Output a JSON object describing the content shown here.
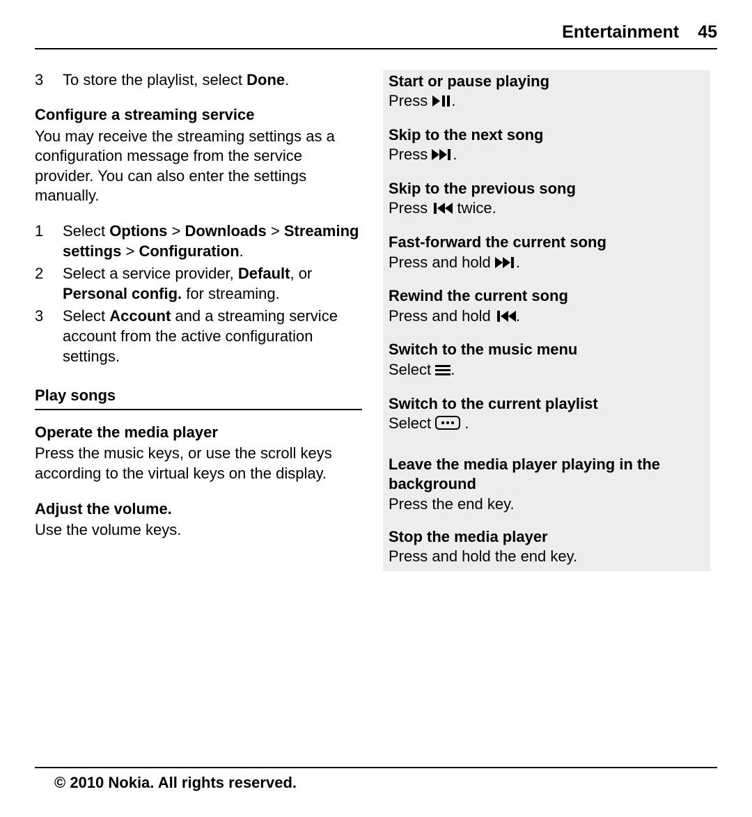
{
  "header": {
    "title": "Entertainment",
    "page_number": "45"
  },
  "left": {
    "intro_step": {
      "num": "3",
      "text_before": "To store the playlist, select ",
      "bold": "Done",
      "text_after": "."
    },
    "configure": {
      "heading": "Configure a streaming service",
      "para": "You may receive the streaming settings as a configuration message from the service provider. You can also enter the settings manually.",
      "steps": [
        {
          "num": "1",
          "parts": [
            "Select ",
            "Options",
            " > ",
            "Downloads",
            " > ",
            "Streaming settings",
            " > ",
            "Configuration",
            "."
          ],
          "bold_flags": [
            false,
            true,
            false,
            true,
            false,
            true,
            false,
            true,
            false
          ]
        },
        {
          "num": "2",
          "parts": [
            "Select a service provider, ",
            "Default",
            ", or ",
            "Personal config.",
            " for streaming."
          ],
          "bold_flags": [
            false,
            true,
            false,
            true,
            false
          ]
        },
        {
          "num": "3",
          "parts": [
            "Select ",
            "Account",
            " and a streaming service account from the active configuration settings."
          ],
          "bold_flags": [
            false,
            true,
            false
          ]
        }
      ]
    },
    "play_heading": "Play songs",
    "operate": {
      "heading": "Operate the media player",
      "para": "Press the music keys, or use the scroll keys according to the virtual keys on the display."
    },
    "volume": {
      "heading": "Adjust the volume.",
      "para": "Use the volume keys."
    }
  },
  "right": {
    "start_pause": {
      "heading": "Start or pause playing",
      "before": "Press ",
      "after": "."
    },
    "next": {
      "heading": "Skip to the next song",
      "before": "Press ",
      "after": "."
    },
    "prev": {
      "heading": "Skip to the previous song",
      "before": "Press ",
      "after": " twice."
    },
    "ffwd": {
      "heading": "Fast-forward the current song",
      "before": "Press and hold ",
      "after": "."
    },
    "rewind": {
      "heading": "Rewind the current song",
      "before": "Press and hold ",
      "after": "."
    },
    "menu": {
      "heading": "Switch to the music menu",
      "before": "Select ",
      "after": "."
    },
    "playlist": {
      "heading": "Switch to the current playlist",
      "before": "Select ",
      "after": " ."
    },
    "background": {
      "heading": "Leave the media player playing in the background",
      "text": "Press the end key."
    },
    "stop": {
      "heading": "Stop the media player",
      "text": "Press and hold the end key."
    }
  },
  "footer": "© 2010 Nokia. All rights reserved."
}
